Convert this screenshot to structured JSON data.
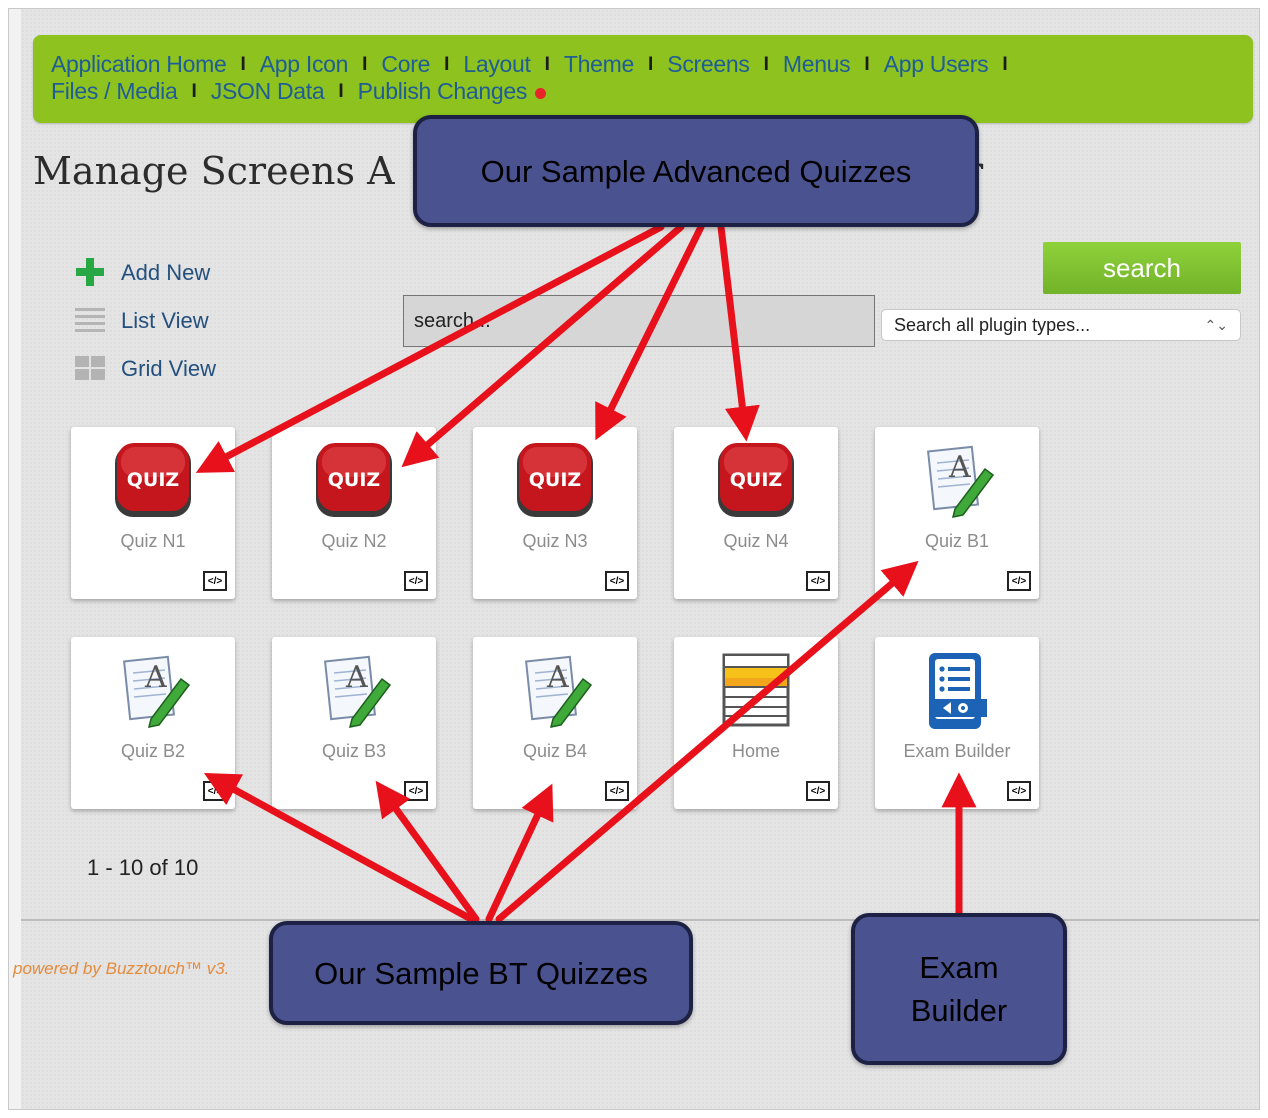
{
  "nav": {
    "row1": [
      "Application Home",
      "App Icon",
      "Core",
      "Layout",
      "Theme",
      "Screens",
      "Menus",
      "App Users"
    ],
    "row2": [
      "Files / Media",
      "JSON Data",
      "Publish Changes"
    ]
  },
  "page_title": "Manage Screens A",
  "page_title_tail": "r",
  "side": {
    "add_new": "Add New",
    "list_view": "List View",
    "grid_view": "Grid View"
  },
  "search": {
    "placeholder": "search...",
    "button": "search",
    "select_value": "Search all plugin types..."
  },
  "tiles": [
    {
      "label": "Quiz N1",
      "icon": "quiz-icon"
    },
    {
      "label": "Quiz N2",
      "icon": "quiz-icon"
    },
    {
      "label": "Quiz N3",
      "icon": "quiz-icon"
    },
    {
      "label": "Quiz N4",
      "icon": "quiz-icon"
    },
    {
      "label": "Quiz B1",
      "icon": "text-edit-icon"
    },
    {
      "label": "Quiz B2",
      "icon": "text-edit-icon"
    },
    {
      "label": "Quiz B3",
      "icon": "text-edit-icon"
    },
    {
      "label": "Quiz B4",
      "icon": "text-edit-icon"
    },
    {
      "label": "Home",
      "icon": "menu-list-icon"
    },
    {
      "label": "Exam Builder",
      "icon": "exam-builder-icon"
    }
  ],
  "quiz_badge_text": "QUIZ",
  "code_badge": "</>",
  "pager": "1 - 10 of 10",
  "footer": "powered by Buzztouch™ v3.",
  "callouts": {
    "advanced": "Our Sample Advanced Quizzes",
    "bt": "Our Sample BT Quizzes",
    "exam_line1": "Exam",
    "exam_line2": "Builder"
  },
  "colors": {
    "nav_bg": "#8dc21f",
    "nav_link": "#1f5d96",
    "callout_bg": "#4a5390",
    "arrow": "#e8101a",
    "search_btn": "#7ec230"
  }
}
